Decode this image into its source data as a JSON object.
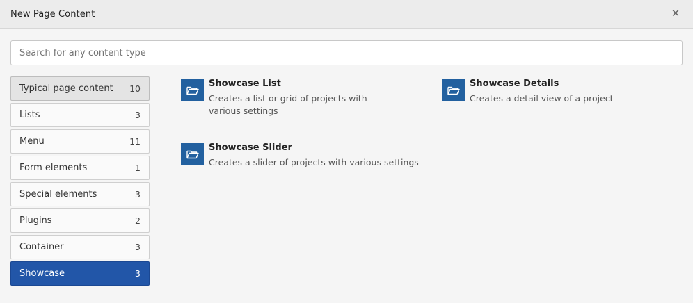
{
  "dialog": {
    "title": "New Page Content",
    "close_icon": "close-icon"
  },
  "search": {
    "placeholder": "Search for any content type",
    "value": ""
  },
  "categories": [
    {
      "label": "Typical page content",
      "count": "10"
    },
    {
      "label": "Lists",
      "count": "3"
    },
    {
      "label": "Menu",
      "count": "11"
    },
    {
      "label": "Form elements",
      "count": "1"
    },
    {
      "label": "Special elements",
      "count": "3"
    },
    {
      "label": "Plugins",
      "count": "2"
    },
    {
      "label": "Container",
      "count": "3"
    },
    {
      "label": "Showcase",
      "count": "3"
    }
  ],
  "selected_category": "Showcase",
  "content_types": [
    {
      "title": "Showcase List",
      "description": "Creates a list or grid of projects with various settings",
      "icon": "folder-open-icon"
    },
    {
      "title": "Showcase Details",
      "description": "Creates a detail view of a project",
      "icon": "folder-open-icon"
    },
    {
      "title": "Showcase Slider",
      "description": "Creates a slider of projects with various settings",
      "icon": "folder-open-icon"
    }
  ],
  "colors": {
    "accent": "#2256a8",
    "icon_bg": "#22609f"
  }
}
